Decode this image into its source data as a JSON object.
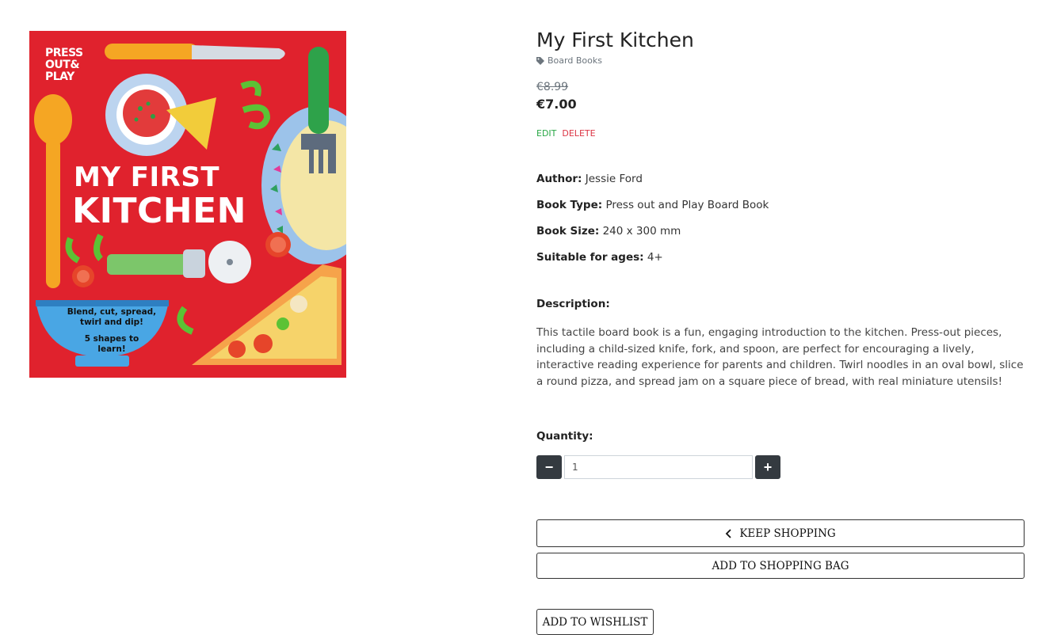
{
  "product": {
    "title": "My First Kitchen",
    "category": "Board Books",
    "old_price": "€8.99",
    "price": "€7.00"
  },
  "admin": {
    "edit_label": "EDIT",
    "delete_label": "DELETE"
  },
  "cover": {
    "brand_lines": [
      "PRESS",
      "OUT&",
      "PLAY"
    ],
    "title_line1": "MY FIRST",
    "title_line2": "KITCHEN",
    "bowl_lines": [
      "Blend, cut, spread,",
      "twirl and dip!",
      "5 shapes to",
      "learn!"
    ],
    "background_color": "#e0222d"
  },
  "specs": {
    "author_label": "Author:",
    "author_value": "Jessie Ford",
    "type_label": "Book Type:",
    "type_value": "Press out and Play Board Book",
    "size_label": "Book Size:",
    "size_value": "240 x 300 mm",
    "ages_label": "Suitable for ages:",
    "ages_value": "4+"
  },
  "description": {
    "heading": "Description:",
    "text": "This tactile board book is a fun, engaging introduction to the kitchen. Press-out pieces, including a child-sized knife, fork, and spoon, are perfect for encouraging a lively, interactive reading experience for parents and children. Twirl noodles in an oval bowl, slice a round pizza, and spread jam on a square piece of bread, with real miniature utensils!"
  },
  "quantity": {
    "label": "Quantity:",
    "value": "1",
    "minus_icon": "minus-icon",
    "plus_icon": "plus-icon"
  },
  "actions": {
    "keep_shopping": "KEEP SHOPPING",
    "add_to_bag": "ADD TO SHOPPING BAG",
    "add_to_wishlist": "ADD TO WISHLIST"
  },
  "colors": {
    "edit": "#28a745",
    "delete": "#dc3545",
    "qty_button": "#343a40"
  }
}
